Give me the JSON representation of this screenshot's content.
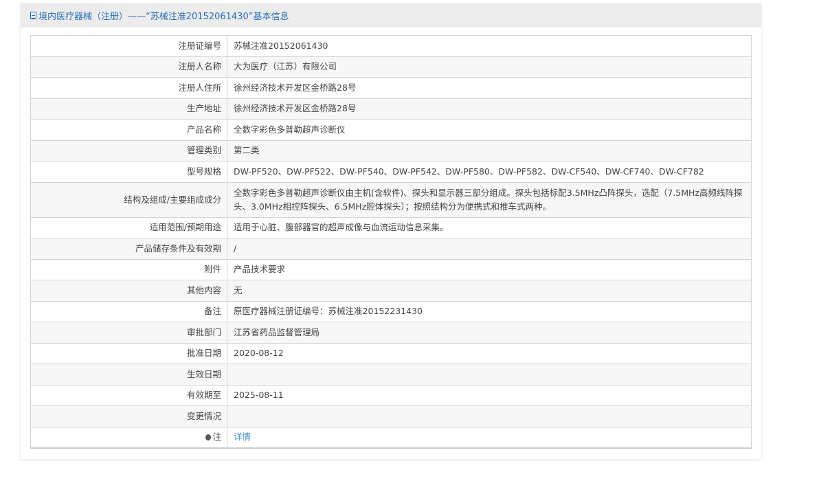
{
  "header": {
    "title": "境内医疗器械（注册）——“苏械注准20152061430”基本信息",
    "icon": "document-icon"
  },
  "rows": [
    {
      "label": "注册证编号",
      "value": "苏械注准20152061430"
    },
    {
      "label": "注册人名称",
      "value": "大为医疗（江苏）有限公司"
    },
    {
      "label": "注册人住所",
      "value": "徐州经济技术开发区金桥路28号"
    },
    {
      "label": "生产地址",
      "value": "徐州经济技术开发区金桥路28号"
    },
    {
      "label": "产品名称",
      "value": "全数字彩色多普勒超声诊断仪"
    },
    {
      "label": "管理类别",
      "value": "第二类"
    },
    {
      "label": "型号规格",
      "value": "DW-PF520、DW-PF522、DW-PF540、DW-PF542、DW-PF580、DW-PF582、DW-CF540、DW-CF740、DW-CF782"
    },
    {
      "label": "结构及组成/主要组成成分",
      "value": "全数字彩色多普勒超声诊断仪由主机(含软件)、探头和显示器三部分组成。探头包括标配3.5MHz凸阵探头，选配（7.5MHz高频线阵探头、3.0MHz相控阵探头、6.5MHz腔体探头）；按照结构分为便携式和推车式两种。"
    },
    {
      "label": "适用范围/预期用途",
      "value": "适用于心脏、腹部器官的超声成像与血流运动信息采集。"
    },
    {
      "label": "产品储存条件及有效期",
      "value": "/"
    },
    {
      "label": "附件",
      "value": "产品技术要求"
    },
    {
      "label": "其他内容",
      "value": "无"
    },
    {
      "label": "备注",
      "value": "原医疗器械注册证编号：苏械注准20152231430"
    },
    {
      "label": "审批部门",
      "value": "江苏省药品监督管理局"
    },
    {
      "label": "批准日期",
      "value": "2020-08-12"
    },
    {
      "label": "生效日期",
      "value": ""
    },
    {
      "label": "有效期至",
      "value": "2025-08-11"
    },
    {
      "label": "变更情况",
      "value": ""
    }
  ],
  "note": {
    "label": "注",
    "link": "详情",
    "icon": "bulb-icon"
  }
}
